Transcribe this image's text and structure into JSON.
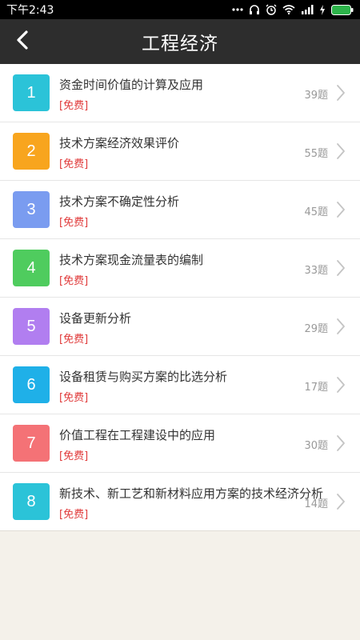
{
  "status_bar": {
    "time": "下午2:43"
  },
  "header": {
    "title": "工程经济",
    "back_icon": "chevron-left-icon"
  },
  "items": [
    {
      "number": "1",
      "title": "资金时间价值的计算及应用",
      "tag": "[免费]",
      "count": "39题",
      "color": "#2bc3d8"
    },
    {
      "number": "2",
      "title": "技术方案经济效果评价",
      "tag": "[免费]",
      "count": "55题",
      "color": "#f8a51e"
    },
    {
      "number": "3",
      "title": "技术方案不确定性分析",
      "tag": "[免费]",
      "count": "45题",
      "color": "#7a9cf0"
    },
    {
      "number": "4",
      "title": "技术方案现金流量表的编制",
      "tag": "[免费]",
      "count": "33题",
      "color": "#4fcc5e"
    },
    {
      "number": "5",
      "title": "设备更新分析",
      "tag": "[免费]",
      "count": "29题",
      "color": "#b17ef0"
    },
    {
      "number": "6",
      "title": "设备租赁与购买方案的比选分析",
      "tag": "[免费]",
      "count": "17题",
      "color": "#1fb0e8"
    },
    {
      "number": "7",
      "title": "价值工程在工程建设中的应用",
      "tag": "[免费]",
      "count": "30题",
      "color": "#f47276"
    },
    {
      "number": "8",
      "title": "新技术、新工艺和新材料应用方案的技术经济分析",
      "tag": "[免费]",
      "count": "14题",
      "color": "#2bc3d8"
    }
  ],
  "colors": {
    "header_bg": "#2d2d2d",
    "page_bg": "#f4f1ea",
    "tag_red": "#e03a3a"
  }
}
